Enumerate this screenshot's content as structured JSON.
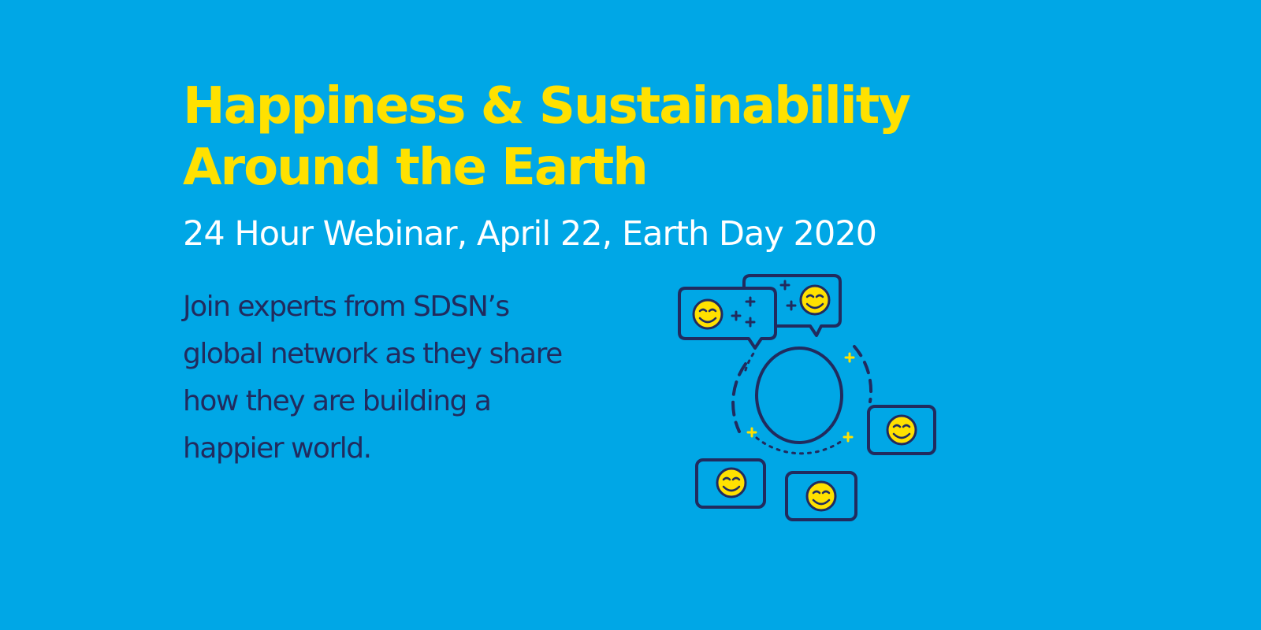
{
  "banner": {
    "title_line1": "Happiness & Sustainability",
    "title_line2": "Around the Earth",
    "subtitle": "24 Hour Webinar, April 22, Earth Day 2020",
    "description_lines": [
      "Join experts from SDSN’s",
      "global network as they share",
      "how they are building a",
      "happier world."
    ]
  },
  "colors": {
    "background": "#00a7e6",
    "title": "#ffe100",
    "subtitle": "#ffffff",
    "description": "#212b5e",
    "icon_outline": "#212b5e",
    "smiley_face": "#ffe100",
    "sparkle": "#ffe100"
  },
  "illustration": {
    "icons": [
      "chat-bubble-icon",
      "smiley-face-icon",
      "globe-ring-icon",
      "video-call-window-icon",
      "sparkle-plus-icon"
    ]
  }
}
